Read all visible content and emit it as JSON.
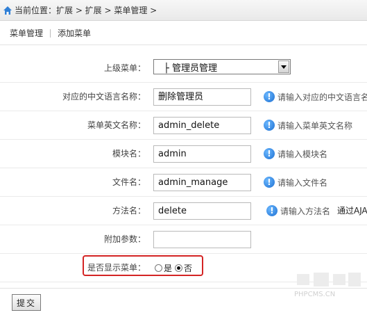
{
  "breadcrumb": {
    "text": "当前位置：扩展 > 扩展 > 菜单管理 >"
  },
  "tabs": [
    {
      "label": "菜单管理"
    },
    {
      "label": "添加菜单"
    }
  ],
  "form": {
    "parent_menu": {
      "label": "上级菜单：",
      "value": "├ 管理员管理"
    },
    "cn_name": {
      "label": "对应的中文语言名称：",
      "value": "删除管理员",
      "hint": "请输入对应的中文语言名"
    },
    "en_name": {
      "label": "菜单英文名称：",
      "value": "admin_delete",
      "hint": "请输入菜单英文名称"
    },
    "module": {
      "label": "模块名：",
      "value": "admin",
      "hint": "请输入模块名"
    },
    "file": {
      "label": "文件名：",
      "value": "admin_manage",
      "hint": "请输入文件名"
    },
    "method": {
      "label": "方法名：",
      "value": "delete",
      "hint": "请输入方法名",
      "extra": "通过AJA"
    },
    "params": {
      "label": "附加参数：",
      "value": ""
    },
    "display": {
      "label": "是否显示菜单：",
      "options": [
        "是",
        "否"
      ],
      "selected": "否"
    }
  },
  "submit": {
    "label": "提交"
  },
  "watermark": "PHPCMS.CN",
  "colors": {
    "highlight": "#d42424",
    "info": "#1d6fd1"
  },
  "icons": {
    "home": "home-icon",
    "info": "info-icon"
  }
}
